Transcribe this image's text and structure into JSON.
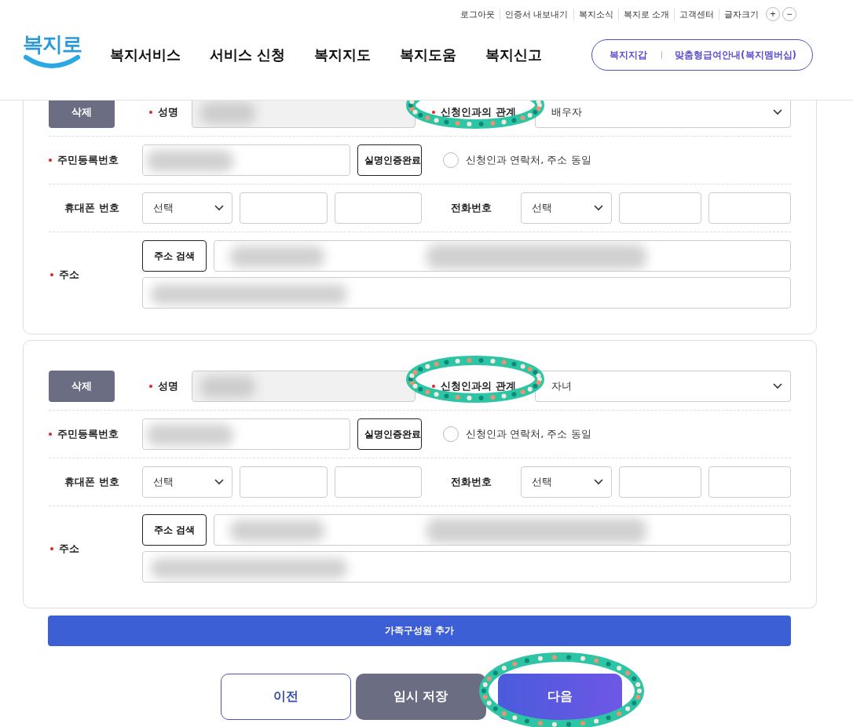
{
  "top_links": [
    "로그아웃",
    "인증서 내보내기",
    "복지소식",
    "복지로 소개",
    "고객센터",
    "글자크기"
  ],
  "font_size_buttons": [
    "+",
    "−"
  ],
  "logo": "복지로",
  "nav": [
    "복지서비스",
    "서비스 신청",
    "복지지도",
    "복지도움",
    "복지신고"
  ],
  "header_buttons": [
    "복지지갑",
    "맞춤형급여안내(복지멤버십)"
  ],
  "members": [
    {
      "delete": "삭제",
      "name": {
        "label": "성명",
        "required": true
      },
      "relation": {
        "label": "신청인과의 관계",
        "required": true,
        "circled": true,
        "value": "배우자"
      },
      "id": {
        "label": "주민등록번호",
        "required": true
      },
      "verify": "실명인증완료",
      "same": {
        "label": "신청인과 연락처, 주소 동일",
        "checked": false
      },
      "mobile": {
        "label": "휴대폰 번호",
        "required": false,
        "carrier": "선택"
      },
      "phone": {
        "label": "전화번호",
        "required": false,
        "prefix": "선택"
      },
      "address": {
        "label": "주소",
        "required": true,
        "search": "주소 검색"
      },
      "redacted": true
    },
    {
      "delete": "삭제",
      "name": {
        "label": "성명",
        "required": true
      },
      "relation": {
        "label": "신청인과의 관계",
        "required": true,
        "circled": true,
        "value": "자녀"
      },
      "id": {
        "label": "주민등록번호",
        "required": true
      },
      "verify": "실명인증완료",
      "same": {
        "label": "신청인과 연락처, 주소 동일",
        "checked": false
      },
      "mobile": {
        "label": "휴대폰 번호",
        "required": false,
        "carrier": "선택"
      },
      "phone": {
        "label": "전화번호",
        "required": false,
        "prefix": "선택"
      },
      "address": {
        "label": "주소",
        "required": true,
        "search": "주소 검색"
      },
      "redacted": true
    }
  ],
  "add_button": "가족구성원 추가",
  "footer_buttons": [
    {
      "label": "이전",
      "kind": "outline",
      "circled": false
    },
    {
      "label": "임시 저장",
      "kind": "gray",
      "circled": false
    },
    {
      "label": "다음",
      "kind": "primary",
      "circled": true
    }
  ]
}
